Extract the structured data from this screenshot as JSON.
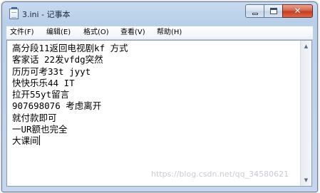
{
  "window": {
    "title": "3.ini - 记事本",
    "buttons": {
      "minimize": "–",
      "maximize": "□",
      "close": "✕"
    }
  },
  "menu": [
    "文件(F)",
    "编辑(E)",
    "格式(O)",
    "查看(V)",
    "帮助(H)"
  ],
  "editor": {
    "lines": [
      "高分段11返回电视剧kf 方式",
      "客家话 22发vfdg突然",
      "历历可考33t jyyt",
      "快快乐乐44 IT",
      "拉开55yt留言",
      "907698076 考虑离开",
      "就付款即可",
      "一UR额也完全",
      "大课间"
    ]
  },
  "scrollbar": {
    "up_arrow": "▲",
    "down_arrow": "▼"
  },
  "watermark": "https://blog.csdn.net/qq_34580621",
  "icons": {
    "app": "notepad-icon",
    "minimize": "minimize-icon",
    "maximize": "maximize-icon",
    "close": "close-icon"
  },
  "colors": {
    "titlebar": "#c9daf0",
    "close_button": "#c43a1e",
    "editor_bg": "#ffffff",
    "watermark": "#c8ccd3"
  }
}
